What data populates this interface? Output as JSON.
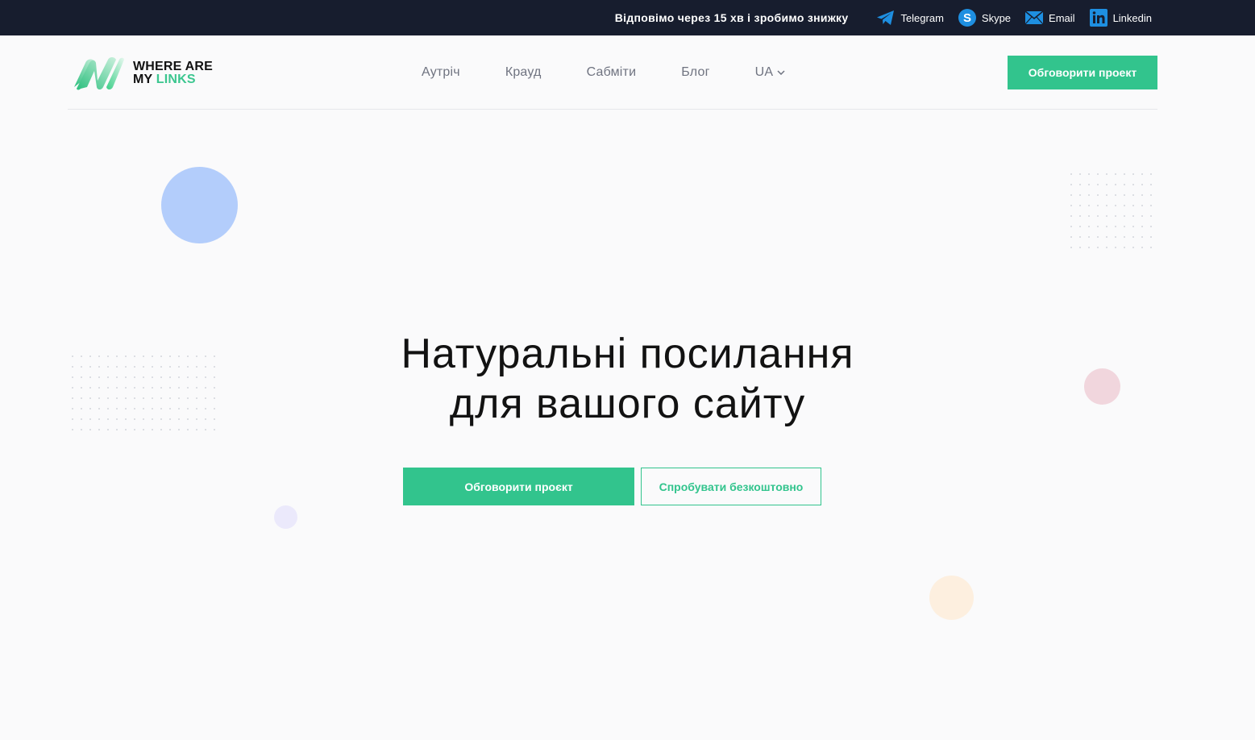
{
  "topbar": {
    "promo": "Відповімо через 15 хв і зробимо знижку",
    "contacts": [
      {
        "label": "Telegram",
        "icon": "telegram-icon"
      },
      {
        "label": "Skype",
        "icon": "skype-icon"
      },
      {
        "label": "Email",
        "icon": "email-icon"
      },
      {
        "label": "Linkedin",
        "icon": "linkedin-icon"
      }
    ]
  },
  "logo": {
    "line1": "WHERE ARE",
    "line2_prefix": "MY ",
    "line2_accent": "LINKS"
  },
  "nav": {
    "items": [
      "Аутріч",
      "Крауд",
      "Сабміти",
      "Блог"
    ],
    "language": "UA"
  },
  "header": {
    "cta_label": "Обговорити проект"
  },
  "hero": {
    "title_line1": "Натуральні посилання",
    "title_line2": "для вашого сайту",
    "primary_label": "Обговорити проєкт",
    "secondary_label": "Спробувати безкоштовно"
  },
  "colors": {
    "topbar_bg": "#171d2e",
    "accent": "#32c48d",
    "page_bg": "#fafafb",
    "icon_blue": "#1e8fe1"
  }
}
